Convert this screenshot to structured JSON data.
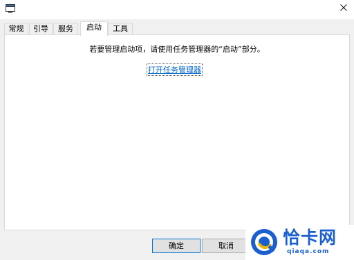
{
  "tabs": [
    {
      "label": "常规",
      "active": false
    },
    {
      "label": "引导",
      "active": false
    },
    {
      "label": "服务",
      "active": false
    },
    {
      "label": "启动",
      "active": true
    },
    {
      "label": "工具",
      "active": false
    }
  ],
  "startup": {
    "message": "若要管理启动项，请使用任务管理器的“启动”部分。",
    "link_label": "打开任务管理器"
  },
  "buttons": {
    "ok_label": "确定",
    "cancel_label": "取消"
  },
  "watermark": {
    "title": "恰卡网",
    "url": "qiaqa.com"
  },
  "colors": {
    "link": "#0066cc",
    "watermark_blue": "#1a5fd0",
    "default_button_border": "#0078d7"
  },
  "icons": {
    "app": "msconfig-window-icon",
    "close": "close-icon"
  }
}
